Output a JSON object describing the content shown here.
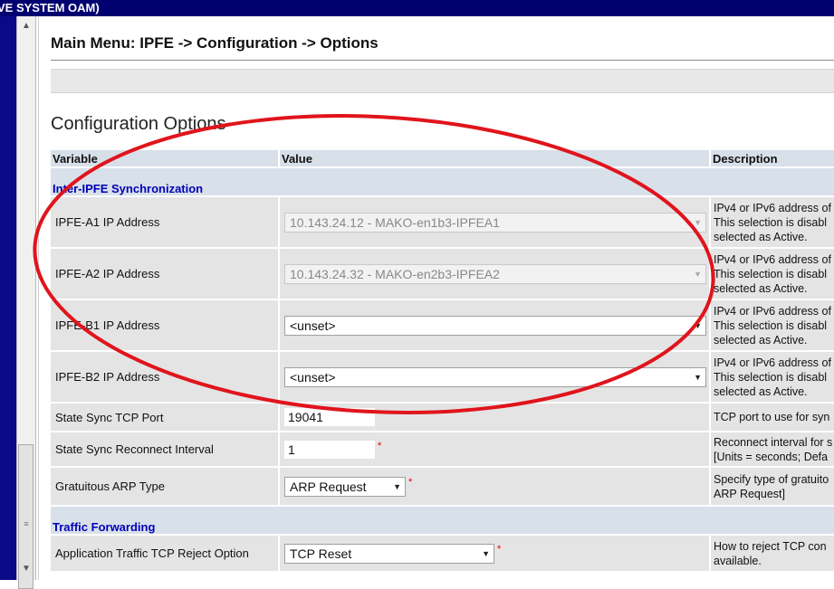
{
  "window": {
    "title": "VE SYSTEM OAM)"
  },
  "breadcrumb": "Main Menu: IPFE -> Configuration -> Options",
  "section_title": "Configuration Options",
  "table": {
    "headers": {
      "variable": "Variable",
      "value": "Value",
      "description": "Description"
    },
    "groups": [
      {
        "name": "Inter-IPFE Synchronization",
        "rows": [
          {
            "variable": "IPFE-A1 IP Address",
            "control": "select",
            "disabled": true,
            "value": "10.143.24.12 - MAKO-en1b3-IPFEA1",
            "required": false,
            "desc": [
              "IPv4 or IPv6 address of",
              "This selection is disabl",
              "selected as Active."
            ]
          },
          {
            "variable": "IPFE-A2 IP Address",
            "control": "select",
            "disabled": true,
            "value": "10.143.24.32 - MAKO-en2b3-IPFEA2",
            "required": false,
            "desc": [
              "IPv4 or IPv6 address of",
              "This selection is disabl",
              "selected as Active."
            ]
          },
          {
            "variable": "IPFE-B1 IP Address",
            "control": "select",
            "disabled": false,
            "value": "<unset>",
            "required": false,
            "desc": [
              "IPv4 or IPv6 address of",
              "This selection is disabl",
              "selected as Active."
            ]
          },
          {
            "variable": "IPFE-B2 IP Address",
            "control": "select",
            "disabled": false,
            "value": "<unset>",
            "required": false,
            "desc": [
              "IPv4 or IPv6 address of",
              "This selection is disabl",
              "selected as Active."
            ]
          },
          {
            "variable": "State Sync TCP Port",
            "control": "text",
            "value": "19041",
            "required": false,
            "desc": [
              "TCP port to use for syn"
            ]
          },
          {
            "variable": "State Sync Reconnect Interval",
            "control": "text",
            "value": "1",
            "required": true,
            "desc": [
              "Reconnect interval for s",
              "[Units = seconds; Defa"
            ]
          },
          {
            "variable": "Gratuitous ARP Type",
            "control": "select",
            "disabled": false,
            "value": "ARP Request",
            "required": true,
            "desc": [
              "Specify type of gratuito",
              "ARP Request]"
            ]
          }
        ]
      },
      {
        "name": "Traffic Forwarding",
        "rows": [
          {
            "variable": "Application Traffic TCP Reject Option",
            "control": "select",
            "disabled": false,
            "value": "TCP Reset",
            "required": true,
            "desc": [
              "How to reject TCP con",
              "available."
            ]
          }
        ]
      }
    ]
  },
  "colors": {
    "annotation_ellipse": "#e0141c",
    "title_bar": "#000070",
    "group_text": "#0000b8"
  }
}
